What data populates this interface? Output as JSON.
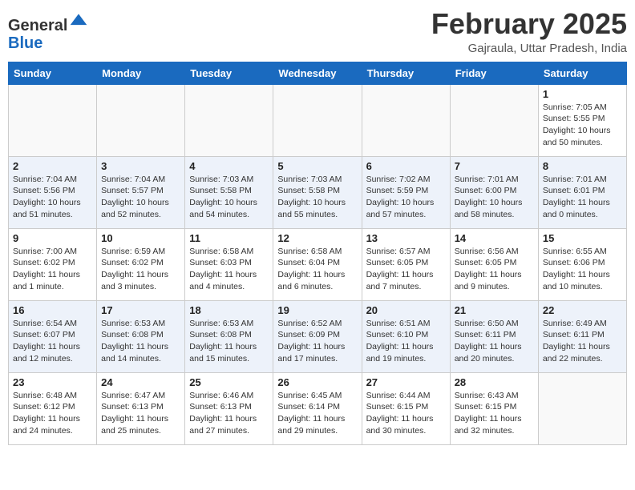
{
  "header": {
    "logo_general": "General",
    "logo_blue": "Blue",
    "month_title": "February 2025",
    "location": "Gajraula, Uttar Pradesh, India"
  },
  "weekdays": [
    "Sunday",
    "Monday",
    "Tuesday",
    "Wednesday",
    "Thursday",
    "Friday",
    "Saturday"
  ],
  "weeks": [
    [
      {
        "day": "",
        "info": ""
      },
      {
        "day": "",
        "info": ""
      },
      {
        "day": "",
        "info": ""
      },
      {
        "day": "",
        "info": ""
      },
      {
        "day": "",
        "info": ""
      },
      {
        "day": "",
        "info": ""
      },
      {
        "day": "1",
        "info": "Sunrise: 7:05 AM\nSunset: 5:55 PM\nDaylight: 10 hours and 50 minutes."
      }
    ],
    [
      {
        "day": "2",
        "info": "Sunrise: 7:04 AM\nSunset: 5:56 PM\nDaylight: 10 hours and 51 minutes."
      },
      {
        "day": "3",
        "info": "Sunrise: 7:04 AM\nSunset: 5:57 PM\nDaylight: 10 hours and 52 minutes."
      },
      {
        "day": "4",
        "info": "Sunrise: 7:03 AM\nSunset: 5:58 PM\nDaylight: 10 hours and 54 minutes."
      },
      {
        "day": "5",
        "info": "Sunrise: 7:03 AM\nSunset: 5:58 PM\nDaylight: 10 hours and 55 minutes."
      },
      {
        "day": "6",
        "info": "Sunrise: 7:02 AM\nSunset: 5:59 PM\nDaylight: 10 hours and 57 minutes."
      },
      {
        "day": "7",
        "info": "Sunrise: 7:01 AM\nSunset: 6:00 PM\nDaylight: 10 hours and 58 minutes."
      },
      {
        "day": "8",
        "info": "Sunrise: 7:01 AM\nSunset: 6:01 PM\nDaylight: 11 hours and 0 minutes."
      }
    ],
    [
      {
        "day": "9",
        "info": "Sunrise: 7:00 AM\nSunset: 6:02 PM\nDaylight: 11 hours and 1 minute."
      },
      {
        "day": "10",
        "info": "Sunrise: 6:59 AM\nSunset: 6:02 PM\nDaylight: 11 hours and 3 minutes."
      },
      {
        "day": "11",
        "info": "Sunrise: 6:58 AM\nSunset: 6:03 PM\nDaylight: 11 hours and 4 minutes."
      },
      {
        "day": "12",
        "info": "Sunrise: 6:58 AM\nSunset: 6:04 PM\nDaylight: 11 hours and 6 minutes."
      },
      {
        "day": "13",
        "info": "Sunrise: 6:57 AM\nSunset: 6:05 PM\nDaylight: 11 hours and 7 minutes."
      },
      {
        "day": "14",
        "info": "Sunrise: 6:56 AM\nSunset: 6:05 PM\nDaylight: 11 hours and 9 minutes."
      },
      {
        "day": "15",
        "info": "Sunrise: 6:55 AM\nSunset: 6:06 PM\nDaylight: 11 hours and 10 minutes."
      }
    ],
    [
      {
        "day": "16",
        "info": "Sunrise: 6:54 AM\nSunset: 6:07 PM\nDaylight: 11 hours and 12 minutes."
      },
      {
        "day": "17",
        "info": "Sunrise: 6:53 AM\nSunset: 6:08 PM\nDaylight: 11 hours and 14 minutes."
      },
      {
        "day": "18",
        "info": "Sunrise: 6:53 AM\nSunset: 6:08 PM\nDaylight: 11 hours and 15 minutes."
      },
      {
        "day": "19",
        "info": "Sunrise: 6:52 AM\nSunset: 6:09 PM\nDaylight: 11 hours and 17 minutes."
      },
      {
        "day": "20",
        "info": "Sunrise: 6:51 AM\nSunset: 6:10 PM\nDaylight: 11 hours and 19 minutes."
      },
      {
        "day": "21",
        "info": "Sunrise: 6:50 AM\nSunset: 6:11 PM\nDaylight: 11 hours and 20 minutes."
      },
      {
        "day": "22",
        "info": "Sunrise: 6:49 AM\nSunset: 6:11 PM\nDaylight: 11 hours and 22 minutes."
      }
    ],
    [
      {
        "day": "23",
        "info": "Sunrise: 6:48 AM\nSunset: 6:12 PM\nDaylight: 11 hours and 24 minutes."
      },
      {
        "day": "24",
        "info": "Sunrise: 6:47 AM\nSunset: 6:13 PM\nDaylight: 11 hours and 25 minutes."
      },
      {
        "day": "25",
        "info": "Sunrise: 6:46 AM\nSunset: 6:13 PM\nDaylight: 11 hours and 27 minutes."
      },
      {
        "day": "26",
        "info": "Sunrise: 6:45 AM\nSunset: 6:14 PM\nDaylight: 11 hours and 29 minutes."
      },
      {
        "day": "27",
        "info": "Sunrise: 6:44 AM\nSunset: 6:15 PM\nDaylight: 11 hours and 30 minutes."
      },
      {
        "day": "28",
        "info": "Sunrise: 6:43 AM\nSunset: 6:15 PM\nDaylight: 11 hours and 32 minutes."
      },
      {
        "day": "",
        "info": ""
      }
    ]
  ]
}
